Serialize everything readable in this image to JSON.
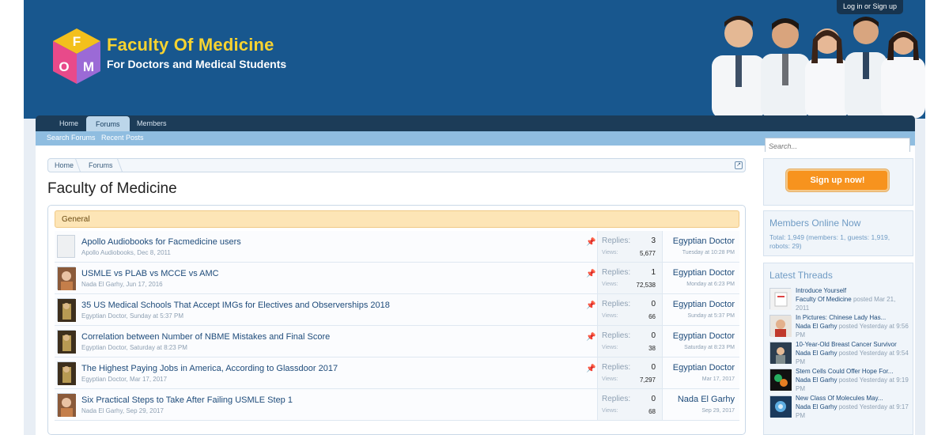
{
  "header": {
    "login_label": "Log in or Sign up",
    "logo_letters": [
      "F",
      "O",
      "M"
    ],
    "logo_title": "Faculty Of Medicine",
    "logo_subtitle": "For Doctors and Medical Students"
  },
  "nav": {
    "tabs": [
      {
        "label": "Home",
        "active": false
      },
      {
        "label": "Forums",
        "active": true
      },
      {
        "label": "Members",
        "active": false
      }
    ],
    "subnav": [
      "Search Forums",
      "Recent Posts"
    ]
  },
  "breadcrumb": [
    "Home",
    "Forums"
  ],
  "page_title": "Faculty of Medicine",
  "category": "General",
  "stats_labels": {
    "replies": "Replies:",
    "views": "Views:"
  },
  "threads": [
    {
      "title": "Apollo Audiobooks for Facmedicine users",
      "author": "Apollo Audiobooks,",
      "date": "Dec 8, 2011",
      "replies": "3",
      "views": "5,677",
      "last_user": "Egyptian Doctor",
      "last_date": "Tuesday at 10:28 PM",
      "sticky": true,
      "avatar": "blank"
    },
    {
      "title": "USMLE vs PLAB vs MCCE vs AMC",
      "author": "Nada El Garhy,",
      "date": "Jun 17, 2016",
      "replies": "1",
      "views": "72,538",
      "last_user": "Egyptian Doctor",
      "last_date": "Monday at 6:23 PM",
      "sticky": true,
      "avatar": "photo"
    },
    {
      "title": "35 US Medical Schools That Accept IMGs for Electives and Observerships 2018",
      "author": "Egyptian Doctor,",
      "date": "Sunday at 5:37 PM",
      "replies": "0",
      "views": "66",
      "last_user": "Egyptian Doctor",
      "last_date": "Sunday at 5:37 PM",
      "sticky": true,
      "avatar": "photo"
    },
    {
      "title": "Correlation between Number of NBME Mistakes and Final Score",
      "author": "Egyptian Doctor,",
      "date": "Saturday at 8:23 PM",
      "replies": "0",
      "views": "38",
      "last_user": "Egyptian Doctor",
      "last_date": "Saturday at 8:23 PM",
      "sticky": true,
      "avatar": "photo"
    },
    {
      "title": "The Highest Paying Jobs in America, According to Glassdoor 2017",
      "author": "Egyptian Doctor,",
      "date": "Mar 17, 2017",
      "replies": "0",
      "views": "7,297",
      "last_user": "Egyptian Doctor",
      "last_date": "Mar 17, 2017",
      "sticky": true,
      "avatar": "photo"
    },
    {
      "title": "Six Practical Steps to Take After Failing USMLE Step 1",
      "author": "Nada El Garhy,",
      "date": "Sep 29, 2017",
      "replies": "0",
      "views": "68",
      "last_user": "Nada El Garhy",
      "last_date": "Sep 29, 2017",
      "sticky": false,
      "avatar": "photo"
    }
  ],
  "sidebar": {
    "search_placeholder": "Search...",
    "signup_label": "Sign up now!",
    "members_online_title": "Members Online Now",
    "members_online_text": "Total: 1,949 (members: 1, guests: 1,919, robots: 29)",
    "latest_title": "Latest Threads",
    "latest": [
      {
        "title": "Introduce Yourself",
        "user": "Faculty Of Medicine",
        "meta": "posted Mar 21, 2011"
      },
      {
        "title": "In Pictures: Chinese Lady Has...",
        "user": "Nada El Garhy",
        "meta": "posted Yesterday at 9:56 PM"
      },
      {
        "title": "10-Year-Old Breast Cancer Survivor",
        "user": "Nada El Garhy",
        "meta": "posted Yesterday at 9:54 PM"
      },
      {
        "title": "Stem Cells Could Offer Hope For...",
        "user": "Nada El Garhy",
        "meta": "posted Yesterday at 9:19 PM"
      },
      {
        "title": "New Class Of Molecules May...",
        "user": "Nada El Garhy",
        "meta": "posted Yesterday at 9:17 PM"
      }
    ]
  },
  "icons": {
    "pin": "pin-icon",
    "jump": "external-link-icon"
  },
  "colors": {
    "header_bg": "#18578e",
    "logo_title": "#f7d330",
    "signup_button": "#f7931e",
    "category_bg": "#fde5b6",
    "link": "#1e4b7a"
  }
}
